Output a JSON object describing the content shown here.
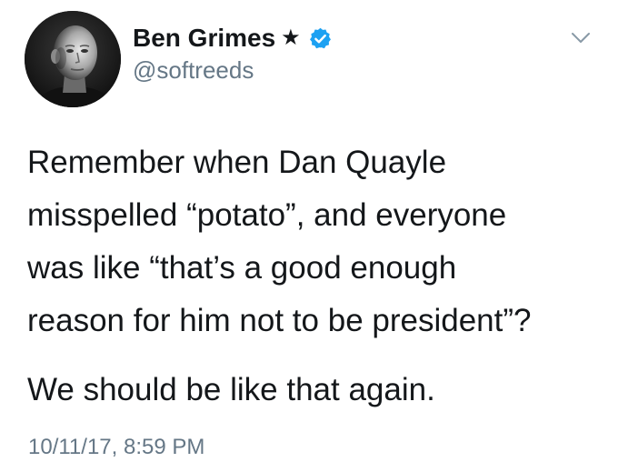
{
  "author": {
    "display_name": "Ben Grimes",
    "star": "★",
    "handle": "@softreeds",
    "verified": true,
    "verified_color": "#1da1f2"
  },
  "tweet": {
    "lines": [
      "Remember when Dan Quayle",
      "misspelled “potato”, and everyone",
      "was like “that’s a good enough",
      "reason for him not to be president”?"
    ],
    "second_paragraph": "We should be like that again.",
    "timestamp": "10/11/17, 8:59 PM"
  },
  "icons": {
    "avatar": "profile-photo",
    "verified": "verified-badge-icon",
    "caret": "chevron-down-icon"
  },
  "colors": {
    "text": "#14171a",
    "secondary": "#657786",
    "background": "#ffffff"
  }
}
